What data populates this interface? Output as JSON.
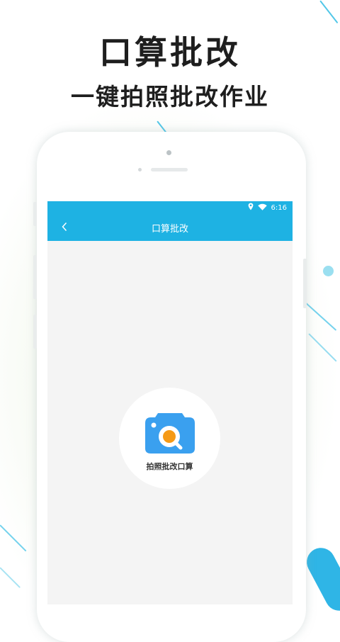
{
  "promo": {
    "headline": "口算批改",
    "subheadline": "一键拍照批改作业"
  },
  "status_bar": {
    "time": "6:16",
    "icons": [
      "location-pin-icon",
      "wifi-icon"
    ]
  },
  "app_bar": {
    "title": "口算批改",
    "back_icon": "chevron-left-icon"
  },
  "capture_button": {
    "label": "拍照批改口算",
    "icon": "camera-search-icon"
  },
  "colors": {
    "accent": "#1eb2e3",
    "camera_body": "#3aa0ef",
    "lens_orange": "#f59a16",
    "screen_bg": "#f4f4f4"
  }
}
